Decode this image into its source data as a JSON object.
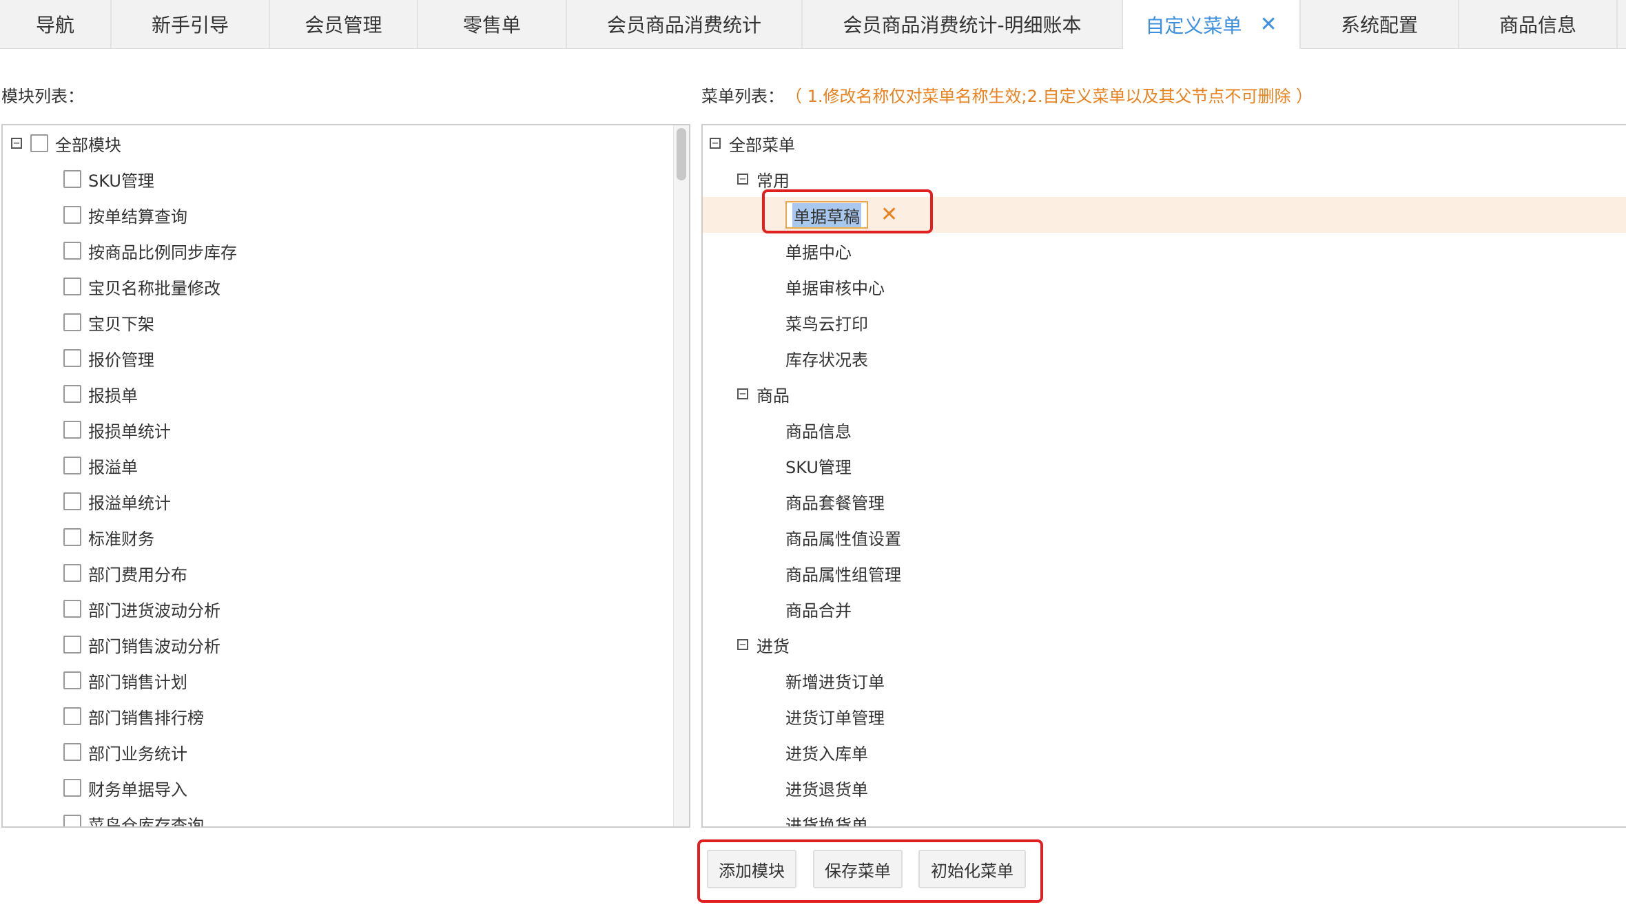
{
  "tabs": [
    {
      "label": "导航"
    },
    {
      "label": "新手引导"
    },
    {
      "label": "会员管理"
    },
    {
      "label": "零售单"
    },
    {
      "label": "会员商品消费统计"
    },
    {
      "label": "会员商品消费统计-明细账本"
    },
    {
      "label": "自定义菜单",
      "active": true,
      "close": "✕"
    },
    {
      "label": "系统配置"
    },
    {
      "label": "商品信息"
    }
  ],
  "module_list": {
    "heading": "模块列表：",
    "root_label": "全部模块",
    "items": [
      "SKU管理",
      "按单结算查询",
      "按商品比例同步库存",
      "宝贝名称批量修改",
      "宝贝下架",
      "报价管理",
      "报损单",
      "报损单统计",
      "报溢单",
      "报溢单统计",
      "标准财务",
      "部门费用分布",
      "部门进货波动分析",
      "部门销售波动分析",
      "部门销售计划",
      "部门销售排行榜",
      "部门业务统计",
      "财务单据导入",
      "菜鸟仓库存查询"
    ]
  },
  "menu_list": {
    "heading": "菜单列表：",
    "note": "（ 1.修改名称仅对菜单名称生效;2.自定义菜单以及其父节点不可删除 ）",
    "root_label": "全部菜单",
    "editing_value": "单据草稿",
    "edit_clear_icon": "✕",
    "groups": [
      {
        "label": "常用",
        "items": [
          "单据中心",
          "单据审核中心",
          "菜鸟云打印",
          "库存状况表"
        ]
      },
      {
        "label": "商品",
        "items": [
          "商品信息",
          "SKU管理",
          "商品套餐管理",
          "商品属性值设置",
          "商品属性组管理",
          "商品合并"
        ]
      },
      {
        "label": "进货",
        "items": [
          "新增进货订单",
          "进货订单管理",
          "进货入库单",
          "进货退货单",
          "进货换货单"
        ]
      }
    ]
  },
  "buttons": {
    "add_module": "添加模块",
    "save_menu": "保存菜单",
    "init_menu": "初始化菜单"
  },
  "colors": {
    "accent": "#3d8fe0",
    "note": "#e8821e",
    "highlight_frame": "#e02020",
    "selected_row": "#fdeee2"
  }
}
